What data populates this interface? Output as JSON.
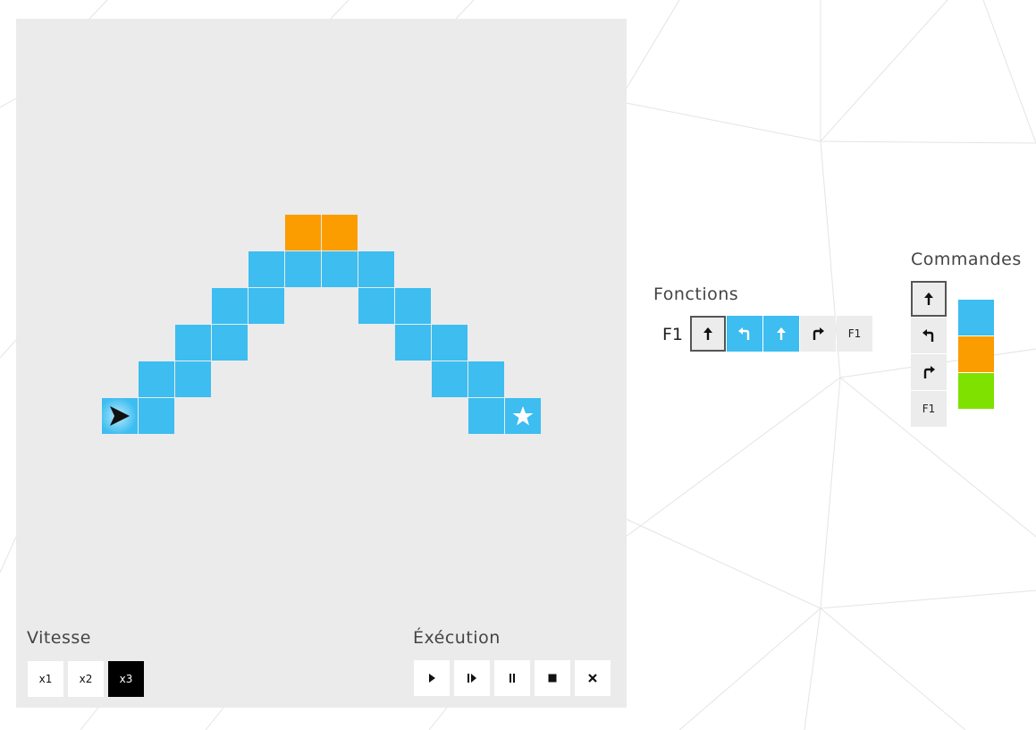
{
  "board": {
    "background": "#ebebeb",
    "tiles": [
      {
        "col": 0,
        "row": 5,
        "color": "blue",
        "content": "robot"
      },
      {
        "col": 1,
        "row": 5,
        "color": "blue"
      },
      {
        "col": 1,
        "row": 4,
        "color": "blue"
      },
      {
        "col": 2,
        "row": 4,
        "color": "blue"
      },
      {
        "col": 2,
        "row": 3,
        "color": "blue"
      },
      {
        "col": 3,
        "row": 3,
        "color": "blue"
      },
      {
        "col": 3,
        "row": 2,
        "color": "blue"
      },
      {
        "col": 4,
        "row": 2,
        "color": "blue"
      },
      {
        "col": 4,
        "row": 1,
        "color": "blue"
      },
      {
        "col": 5,
        "row": 1,
        "color": "blue"
      },
      {
        "col": 5,
        "row": 0,
        "color": "orange"
      },
      {
        "col": 6,
        "row": 1,
        "color": "blue"
      },
      {
        "col": 6,
        "row": 0,
        "color": "orange"
      },
      {
        "col": 7,
        "row": 1,
        "color": "blue"
      },
      {
        "col": 7,
        "row": 2,
        "color": "blue"
      },
      {
        "col": 8,
        "row": 2,
        "color": "blue"
      },
      {
        "col": 8,
        "row": 3,
        "color": "blue"
      },
      {
        "col": 9,
        "row": 3,
        "color": "blue"
      },
      {
        "col": 9,
        "row": 4,
        "color": "blue"
      },
      {
        "col": 10,
        "row": 4,
        "color": "blue"
      },
      {
        "col": 10,
        "row": 5,
        "color": "blue"
      },
      {
        "col": 11,
        "row": 5,
        "color": "blue",
        "content": "star"
      }
    ],
    "robot_direction": "right"
  },
  "colors": {
    "blue": "#3dbdf0",
    "orange": "#fb9c00",
    "green": "#7fe100",
    "active_button": "#000000"
  },
  "speed": {
    "label": "Vitesse",
    "options": [
      "x1",
      "x2",
      "x3"
    ],
    "selected": "x3"
  },
  "execution": {
    "label": "Éxécution",
    "buttons": [
      {
        "name": "play-button",
        "icon": "play-icon"
      },
      {
        "name": "step-button",
        "icon": "step-icon"
      },
      {
        "name": "pause-button",
        "icon": "pause-icon"
      },
      {
        "name": "stop-button",
        "icon": "stop-icon"
      },
      {
        "name": "clear-button",
        "icon": "close-icon"
      }
    ]
  },
  "functions": {
    "label": "Fonctions",
    "f1": {
      "name": "F1",
      "slots": [
        {
          "icon": "arrow-up-icon",
          "color": "none",
          "selected": true
        },
        {
          "icon": "turn-left-icon",
          "color": "blue"
        },
        {
          "icon": "arrow-up-icon",
          "color": "blue"
        },
        {
          "icon": "turn-right-icon",
          "color": "none"
        },
        {
          "text": "F1",
          "color": "none"
        }
      ]
    }
  },
  "commands": {
    "label": "Commandes",
    "items": [
      {
        "icon": "arrow-up-icon",
        "selected": true
      },
      {
        "icon": "turn-left-icon"
      },
      {
        "icon": "turn-right-icon"
      },
      {
        "text": "F1"
      }
    ],
    "swatches": [
      "blue",
      "orange",
      "green"
    ]
  }
}
